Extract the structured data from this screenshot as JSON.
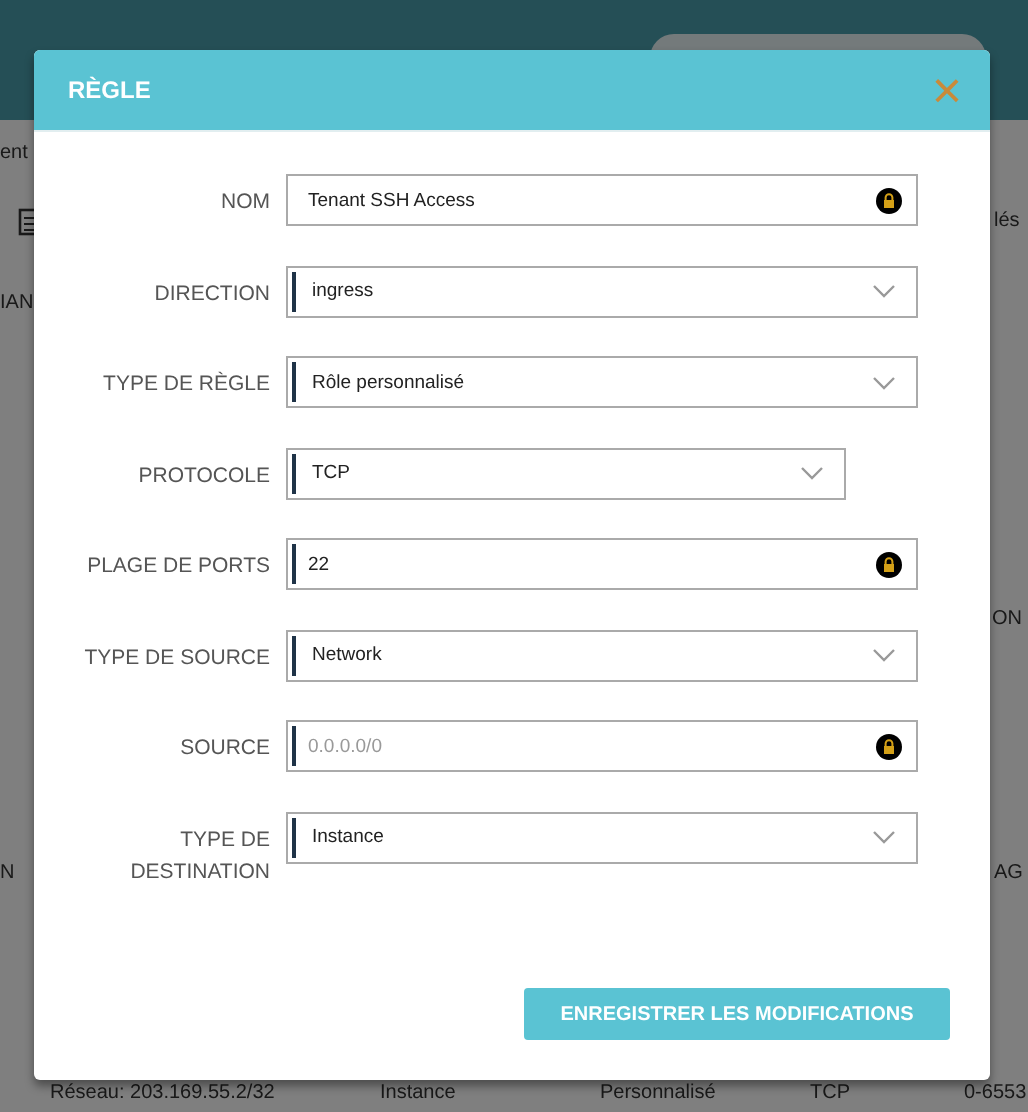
{
  "background": {
    "fragments": [
      "ent",
      "lés",
      "IAN",
      "ON",
      "N",
      "AG"
    ],
    "bottom_row": [
      "Réseau: 203.169.55.2/32",
      "Instance",
      "Personnalisé",
      "TCP",
      "0-6553"
    ]
  },
  "dialog": {
    "title": "RÈGLE",
    "close": "×",
    "fields": [
      {
        "label": "NOM",
        "kind": "text",
        "value": "Tenant SSH Access",
        "focused": false,
        "locked": true,
        "wide": true
      },
      {
        "label": "DIRECTION",
        "kind": "select",
        "value": "ingress",
        "focused": true,
        "wide": true
      },
      {
        "label": "TYPE DE RÈGLE",
        "kind": "select",
        "value": "Rôle personnalisé",
        "focused": true,
        "wide": true
      },
      {
        "label": "PROTOCOLE",
        "kind": "select",
        "value": "TCP",
        "focused": true,
        "wide": false
      },
      {
        "label": "PLAGE DE PORTS",
        "kind": "text",
        "value": "22",
        "focused": true,
        "locked": true,
        "wide": true
      },
      {
        "label": "TYPE DE SOURCE",
        "kind": "select",
        "value": "Network",
        "focused": true,
        "wide": true
      },
      {
        "label": "SOURCE",
        "kind": "text",
        "placeholder": "0.0.0.0/0",
        "focused": true,
        "locked": true,
        "wide": true
      },
      {
        "label": "TYPE DE DESTINATION",
        "kind": "select",
        "value": "Instance",
        "focused": true,
        "wide": true
      }
    ],
    "save_button": "ENREGISTRER LES MODIFICATIONS"
  }
}
